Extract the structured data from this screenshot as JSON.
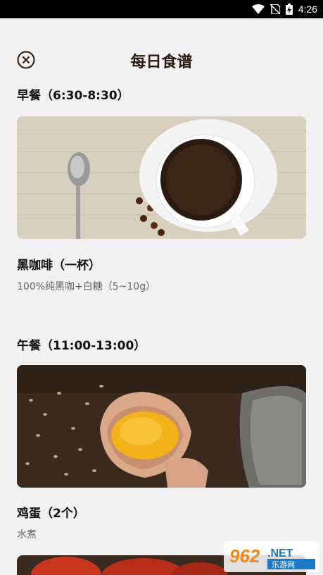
{
  "status": {
    "time": "4:26"
  },
  "header": {
    "title": "每日食谱"
  },
  "meals": [
    {
      "title": "早餐（6:30-8:30）",
      "food": "黑咖啡（一杯）",
      "desc": "100%纯黑咖+白糖（5~10g）",
      "image": "black-coffee-photo"
    },
    {
      "title": "午餐（11:00-13:00）",
      "food": "鸡蛋（2个）",
      "desc": "水煮",
      "image": "boiled-egg-photo"
    },
    {
      "image": "tomato-photo"
    }
  ],
  "watermark": {
    "text1": "962",
    "text2": ".NET",
    "text3": "乐游网"
  }
}
